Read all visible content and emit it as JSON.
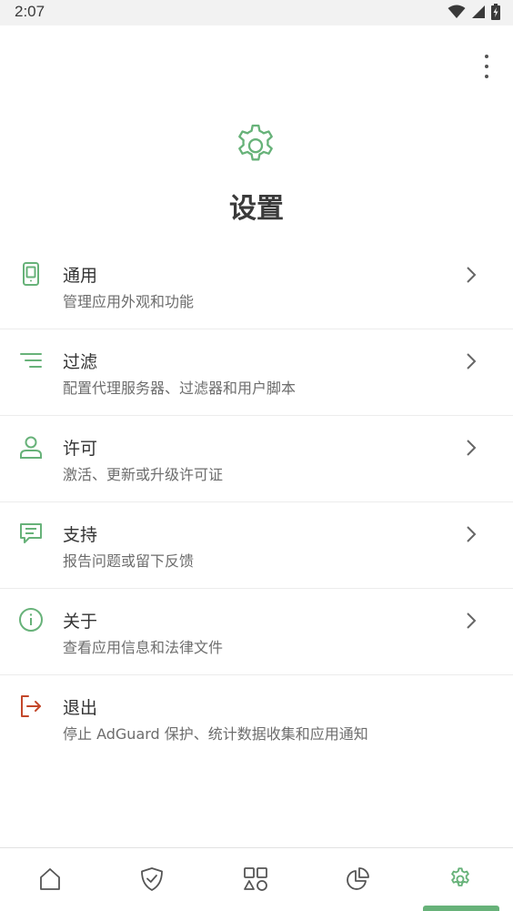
{
  "status_bar": {
    "time": "2:07",
    "icons": [
      "wifi-icon",
      "cellular-signal-icon",
      "battery-charging-icon"
    ]
  },
  "header": {
    "icon": "gear-icon",
    "title": "设置",
    "menu_icon": "more-vertical-icon"
  },
  "settings": [
    {
      "icon": "phone-icon",
      "title": "通用",
      "subtitle": "管理应用外观和功能",
      "has_chevron": true
    },
    {
      "icon": "filter-icon",
      "title": "过滤",
      "subtitle": "配置代理服务器、过滤器和用户脚本",
      "has_chevron": true
    },
    {
      "icon": "person-icon",
      "title": "许可",
      "subtitle": "激活、更新或升级许可证",
      "has_chevron": true
    },
    {
      "icon": "chat-icon",
      "title": "支持",
      "subtitle": "报告问题或留下反馈",
      "has_chevron": true
    },
    {
      "icon": "info-icon",
      "title": "关于",
      "subtitle": "查看应用信息和法律文件",
      "has_chevron": true
    },
    {
      "icon": "logout-icon",
      "title": "退出",
      "subtitle": "停止 AdGuard 保护、统计数据收集和应用通知",
      "has_chevron": false
    }
  ],
  "bottom_nav": {
    "items": [
      "home-icon",
      "shield-icon",
      "apps-icon",
      "statistics-icon",
      "settings-gear-icon"
    ],
    "active": "settings-gear-icon"
  },
  "colors": {
    "accent_green": "#67b279",
    "logout_red": "#c3472a",
    "text_primary": "#333333",
    "text_secondary": "#6d6d6d"
  }
}
